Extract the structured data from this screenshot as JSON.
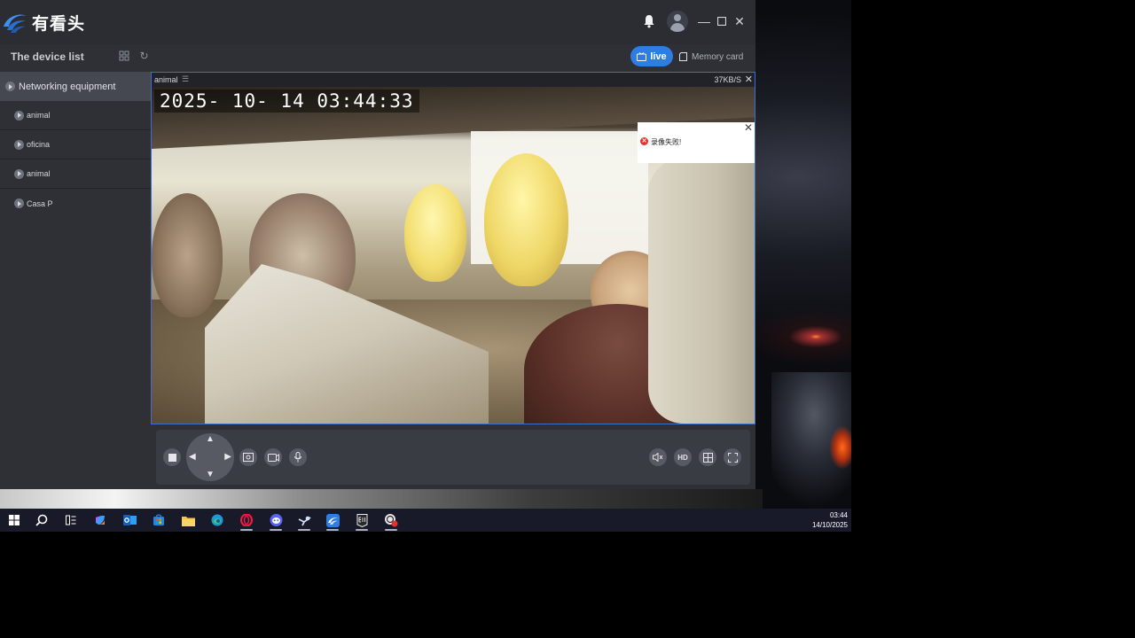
{
  "app": {
    "logo_text": "有看头",
    "device_list_title": "The device list",
    "live_label": "live",
    "memory_label": "Memory card"
  },
  "sidebar": {
    "group_label": "Networking equipment",
    "devices": [
      {
        "label": "animal"
      },
      {
        "label": "oficina"
      },
      {
        "label": "animal"
      },
      {
        "label": "Casa P"
      }
    ]
  },
  "video": {
    "camera_name": "animal",
    "bitrate": "37KB/S",
    "osd_timestamp": "2025- 10- 14   03:44:33",
    "error_message": "录像失败!"
  },
  "controls": {
    "hd_label": "HD"
  },
  "taskbar": {
    "time": "03:44",
    "date": "14/10/2025"
  },
  "colors": {
    "accent": "#2f7de1",
    "error": "#e0322f",
    "selection_border": "#3c6fd0"
  }
}
